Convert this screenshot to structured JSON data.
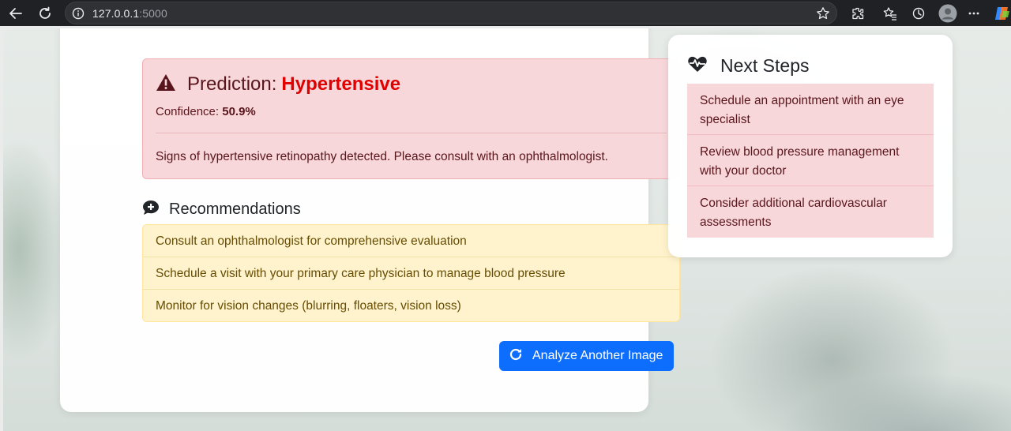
{
  "browser": {
    "url_host": "127.0.0.1",
    "url_port": ":5000",
    "icons": [
      "back-arrow-icon",
      "reload-icon",
      "info-icon",
      "star-icon",
      "extensions-icon",
      "favorites-icon",
      "history-icon",
      "profile-avatar-icon",
      "copilot-icon"
    ]
  },
  "prediction": {
    "label": "Prediction:",
    "value": "Hypertensive",
    "confidence_label": "Confidence:",
    "confidence_value": "50.9%",
    "message": "Signs of hypertensive retinopathy detected. Please consult with an ophthalmologist.",
    "icon": "warning-triangle-icon"
  },
  "recommendations": {
    "title": "Recommendations",
    "icon": "comment-plus-icon",
    "items": [
      "Consult an ophthalmologist for comprehensive evaluation",
      "Schedule a visit with your primary care physician to manage blood pressure",
      "Monitor for vision changes (blurring, floaters, vision loss)"
    ]
  },
  "actions": {
    "analyze_label": "Analyze Another Image",
    "analyze_icon": "redo-icon"
  },
  "next_steps": {
    "title": "Next Steps",
    "icon": "heartbeat-icon",
    "items": [
      "Schedule an appointment with an eye specialist",
      "Review blood pressure management with your doctor",
      "Consider additional cardiovascular assessments"
    ]
  },
  "colors": {
    "danger_bg": "#f8d7da",
    "danger_text": "#58151c",
    "prediction_value": "#e00000",
    "warning_bg": "#fff3cd",
    "warning_text": "#664d03",
    "primary": "#0d6efd"
  }
}
